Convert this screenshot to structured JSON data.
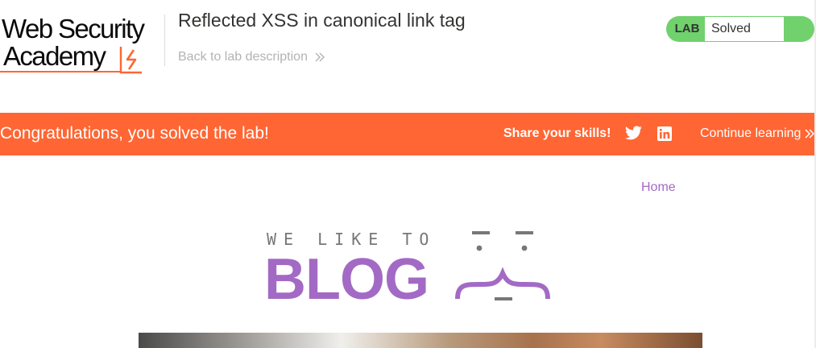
{
  "header": {
    "logo_line1": "Web Security",
    "logo_line2": "Academy",
    "lab_title": "Reflected XSS in canonical link tag",
    "back_link": "Back to lab description",
    "status_label": "LAB",
    "status_value": "Solved",
    "status_color": "#70d16d"
  },
  "banner": {
    "message": "Congratulations, you solved the lab!",
    "share_label": "Share your skills!",
    "share_icons": [
      "twitter-icon",
      "linkedin-icon"
    ],
    "continue_label": "Continue learning",
    "background": "#ff6633"
  },
  "blog": {
    "nav_home": "Home",
    "tagline": "WE LIKE TO",
    "title": "BLOG",
    "accent": "#a36ac5"
  }
}
